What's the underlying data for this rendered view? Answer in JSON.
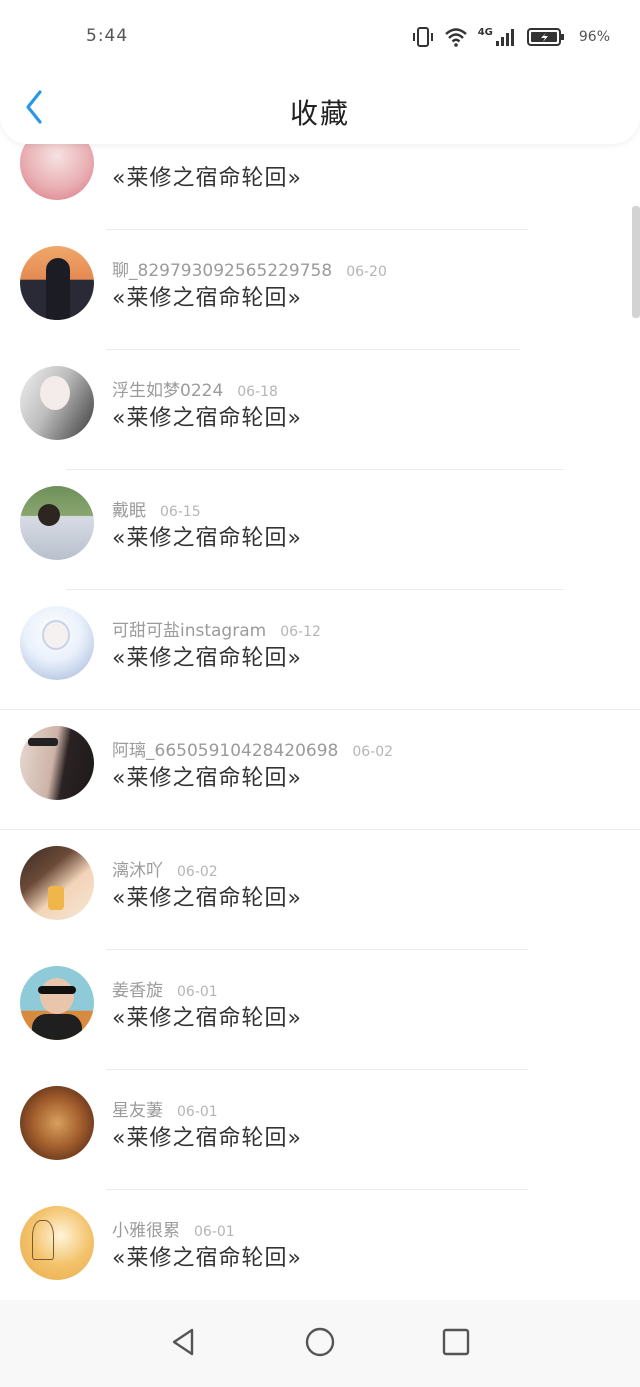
{
  "status_bar": {
    "time": "5:44",
    "battery_pct": "96%",
    "network": "4G"
  },
  "header": {
    "title": "收藏",
    "back_icon": "chevron-left-icon"
  },
  "accent_color": "#2a98e6",
  "items": [
    {
      "user": "",
      "date": "",
      "book": "«莱修之宿命轮回»",
      "avatar_colors": [
        "#f6e2e2",
        "#d9747c"
      ]
    },
    {
      "user": "聊_829793092565229758",
      "date": "06-20",
      "book": "«莱修之宿命轮回»",
      "avatar_colors": [
        "#f0a86a",
        "#2a2a36"
      ]
    },
    {
      "user": "浮生如梦0224",
      "date": "06-18",
      "book": "«莱修之宿命轮回»",
      "avatar_colors": [
        "#e7e7e7",
        "#3a3a3a"
      ]
    },
    {
      "user": "戴眠",
      "date": "06-15",
      "book": "«莱修之宿命轮回»",
      "avatar_colors": [
        "#6e8f5a",
        "#d7dbe4"
      ]
    },
    {
      "user": "可甜可盐instagram",
      "date": "06-12",
      "book": "«莱修之宿命轮回»",
      "avatar_colors": [
        "#eaf1fb",
        "#9cb3d9"
      ]
    },
    {
      "user": "阿璃_66505910428420698",
      "date": "06-02",
      "book": "«莱修之宿命轮回»",
      "avatar_colors": [
        "#e8d9d2",
        "#2b2323"
      ]
    },
    {
      "user": "漓沐吖",
      "date": "06-02",
      "book": "«莱修之宿命轮回»",
      "avatar_colors": [
        "#f2d4b8",
        "#3a2b22"
      ]
    },
    {
      "user": "姜香旋",
      "date": "06-01",
      "book": "«莱修之宿命轮回»",
      "avatar_colors": [
        "#8fcad8",
        "#1f1f1f"
      ]
    },
    {
      "user": "星友萋",
      "date": "06-01",
      "book": "«莱修之宿命轮回»",
      "avatar_colors": [
        "#c98b4e",
        "#6d3a1e"
      ]
    },
    {
      "user": "小雅很累",
      "date": "06-01",
      "book": "«莱修之宿命轮回»",
      "avatar_colors": [
        "#f3c26a",
        "#e9a94a"
      ]
    }
  ],
  "nav": {
    "back_icon": "triangle-back-icon",
    "home_icon": "circle-home-icon",
    "recents_icon": "square-recents-icon"
  }
}
